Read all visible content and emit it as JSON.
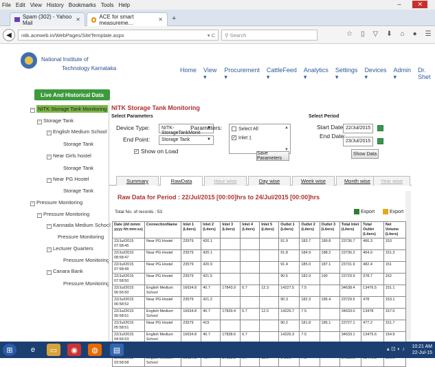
{
  "menu": [
    "File",
    "Edit",
    "View",
    "History",
    "Bookmarks",
    "Tools",
    "Help"
  ],
  "window": {
    "minimize": "–",
    "close": "✕"
  },
  "tabs": [
    {
      "title": "Spam (302) - Yahoo Mail",
      "close": "✕"
    },
    {
      "title": "ACE for smart measureme...",
      "close": "✕"
    }
  ],
  "new_tab": "+",
  "url": "nitk.aceweb.in/WebPages/SiteTemplate.aspx",
  "search_placeholder": "Search",
  "institute": {
    "line1": "National Institute of",
    "line2": "Technology Karnataka"
  },
  "nav": [
    "Home",
    "View ▾",
    "Procurement ▾",
    "CattleFeed ▾",
    "Analytics ▾",
    "Settings ▾",
    "Devices ▾",
    "Admin ▾",
    "Dr. Shet"
  ],
  "live_button": "Live And Historical Data",
  "tree": [
    {
      "label": "NITK Storage Tank Monitoring",
      "selected": true
    },
    {
      "label": "Storage Tank"
    },
    {
      "label": "English Medium School"
    },
    {
      "label": "Storage Tank"
    },
    {
      "label": "Near Girls hostel"
    },
    {
      "label": "Storage Tank"
    },
    {
      "label": "Near PG Hostel"
    },
    {
      "label": "Storage Tank"
    },
    {
      "label": "Pressure Monitoring"
    },
    {
      "label": "Pressure Monitoring"
    },
    {
      "label": "Kannada Medium School"
    },
    {
      "label": "Pressure Monitoring"
    },
    {
      "label": "Lecturer Quarters"
    },
    {
      "label": "Pressure Monitoring"
    },
    {
      "label": "Canara Bank"
    },
    {
      "label": "Pressure Monitoring"
    }
  ],
  "panel": {
    "title": "NITK Storage Tank Monitoring",
    "select_parameters": "Select Parameters",
    "device_type_label": "Device Type:",
    "device_type_value": "NITK-StorageTankMonit",
    "end_point_label": "End Point:",
    "end_point_value": "Storage Tank",
    "show_on_load": "Show on Load",
    "parameters_label": "Parameters:",
    "param_options": [
      "Select All",
      "Inlet 1"
    ],
    "save_parameters": "Save Parameters",
    "select_period": "Select Period",
    "start_date_label": "Start Date:",
    "start_date": "22/Jul/2015",
    "end_date_label": "End Date:",
    "end_date": "23/Jul/2015",
    "show_data": "Show Data"
  },
  "subtabs": [
    "Summary",
    "RawData",
    "Hour wise",
    "Day wise",
    "Week wise",
    "Month wise",
    "Year wise"
  ],
  "raw_title": "Raw Data for Period : 22/Jul/2015 [00:00]hrs to 24/Jul/2015 [00:00]hrs",
  "total_records": "Total No. of records : 53",
  "export1": "Export",
  "export2": "Export",
  "table": {
    "headers": [
      "Date (dd mmm yyyy hh:mm:ss)",
      "ConnectionName",
      "Inlet 1 (Liters)",
      "Inlet 2 (Liters)",
      "Inlet 3 (Liters)",
      "Inlet 4 (Liters)",
      "Inlet 5 (Liters)",
      "Outlet 1 (Liters)",
      "Outlet 2 (Liters)",
      "Outlet 3 (Liters)",
      "Total Inlet (Liters)",
      "Total Outlet (Liters)",
      "Net Volume (Liters)"
    ],
    "rows": [
      [
        "22/Jul/2015 07:58:45",
        "Near PG Hostel",
        "23579",
        "420.1",
        "",
        "",
        "",
        "91.9",
        "183.7",
        "189.8",
        "23736.7",
        "466.3",
        "153"
      ],
      [
        "22/Jul/2015 08:58:47",
        "Near PG Hostel",
        "23579",
        "420.1",
        "",
        "",
        "",
        "91.8",
        "184.9",
        "188.2",
        "23736.2",
        "464.9",
        "151.3"
      ],
      [
        "22/Jul/2015 07:58:49",
        "Near PG Hostel",
        "23579",
        "420.9",
        "",
        "",
        "",
        "91.4",
        "185.0",
        "187.1",
        "23731.9",
        "482.4",
        "151"
      ],
      [
        "22/Jul/2015 07:58:50",
        "Near PG Hostel",
        "23579",
        "421.5",
        "",
        "",
        "",
        "90.5",
        "182.9",
        "190",
        "23729.9",
        "378.7",
        "152"
      ],
      [
        "22/Jul/2015 06:56:50",
        "English Medium School",
        "16634.8",
        "40.7",
        "17843.9",
        "6.7",
        "12.3",
        "14227.5",
        "7.5",
        "",
        "34638.4",
        "13476.5",
        "151.1"
      ],
      [
        "22/Jul/2015 06:58:52",
        "Near PG Hostel",
        "23579",
        "421.2",
        "",
        "",
        "",
        "90.3",
        "182.3",
        "185.4",
        "23729.5",
        "478",
        "153.1"
      ],
      [
        "22/Jul/2015 05:58:51",
        "English Medium School",
        "16634.8",
        "40.7",
        "17839.4",
        "6.7",
        "12.0",
        "14226.7",
        "7.5",
        "",
        "34633.0",
        "13478",
        "157.0"
      ],
      [
        "22/Jul/2015 05:58:51",
        "Near PG Hostel",
        "23579",
        "419",
        "",
        "",
        "",
        "90.2",
        "181.8",
        "185.1",
        "23727.1",
        "477.2",
        "151.7"
      ],
      [
        "22/Jul/2015 04:56:53",
        "English Medium School",
        "16634.8",
        "40.7",
        "17838.6",
        "6.7",
        "",
        "14226.3",
        "7.5",
        "",
        "34633.1",
        "13475.6",
        "154.9"
      ],
      [
        "22/Jul/2015 04:56:56",
        "Near PG Hostel",
        "23579",
        "417.1",
        "",
        "",
        "",
        "90.2",
        "181.7",
        "185.1",
        "23725.2",
        "477",
        "150"
      ],
      [
        "22/Jul/2015 03:58:58",
        "English Medium School",
        "16634.8",
        "40.7",
        "17838.5",
        "6.7",
        "12.0",
        "14226",
        "7.5",
        "",
        "34632.8",
        "13476.5",
        "156.0"
      ]
    ]
  },
  "clock": {
    "time": "10:21 AM",
    "date": "22-Jul-15"
  }
}
